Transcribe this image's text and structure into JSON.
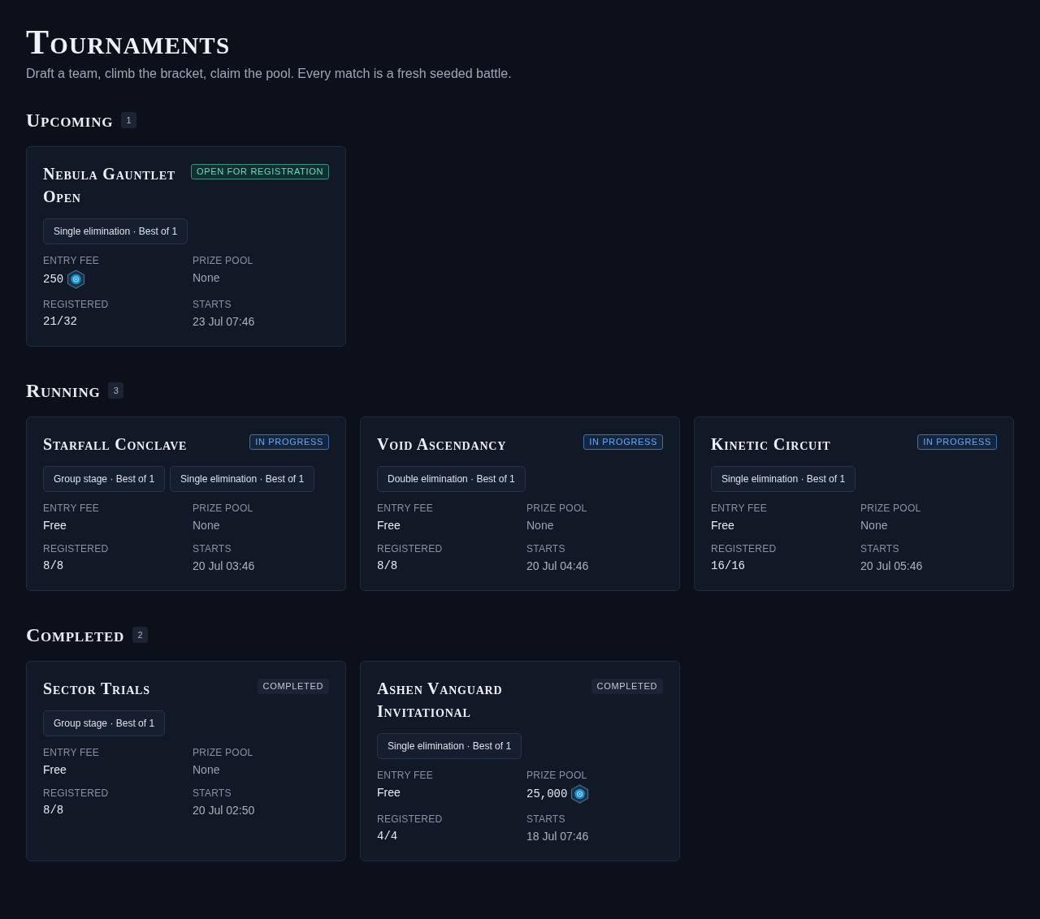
{
  "page": {
    "title": "Tournaments",
    "subtitle": "Draft a team, climb the bracket, claim the pool. Every match is a fresh seeded battle."
  },
  "sections": [
    {
      "title": "Upcoming",
      "count": "1",
      "cards": [
        {
          "title": "Nebula Gauntlet Open",
          "status": {
            "label": "OPEN FOR REGISTRATION",
            "kind": "open"
          },
          "formats": [
            "Single elimination · Best of 1"
          ],
          "stats": [
            {
              "label": "ENTRY FEE",
              "value": "250",
              "kind": "coins"
            },
            {
              "label": "PRIZE POOL",
              "value": "None",
              "kind": "none"
            },
            {
              "label": "REGISTERED",
              "value": "21/32",
              "kind": "count"
            },
            {
              "label": "STARTS",
              "value": "23 Jul 07:46",
              "kind": "date"
            }
          ]
        }
      ]
    },
    {
      "title": "Running",
      "count": "3",
      "cards": [
        {
          "title": "Starfall Conclave",
          "status": {
            "label": "IN PROGRESS",
            "kind": "running"
          },
          "formats": [
            "Group stage · Best of 1",
            "Single elimination · Best of 1"
          ],
          "stats": [
            {
              "label": "ENTRY FEE",
              "value": "Free",
              "kind": "free"
            },
            {
              "label": "PRIZE POOL",
              "value": "None",
              "kind": "none"
            },
            {
              "label": "REGISTERED",
              "value": "8/8",
              "kind": "count"
            },
            {
              "label": "STARTS",
              "value": "20 Jul 03:46",
              "kind": "date"
            }
          ]
        },
        {
          "title": "Void Ascendancy",
          "status": {
            "label": "IN PROGRESS",
            "kind": "running"
          },
          "formats": [
            "Double elimination · Best of 1"
          ],
          "stats": [
            {
              "label": "ENTRY FEE",
              "value": "Free",
              "kind": "free"
            },
            {
              "label": "PRIZE POOL",
              "value": "None",
              "kind": "none"
            },
            {
              "label": "REGISTERED",
              "value": "8/8",
              "kind": "count"
            },
            {
              "label": "STARTS",
              "value": "20 Jul 04:46",
              "kind": "date"
            }
          ]
        },
        {
          "title": "Kinetic Circuit",
          "status": {
            "label": "IN PROGRESS",
            "kind": "running"
          },
          "formats": [
            "Single elimination · Best of 1"
          ],
          "stats": [
            {
              "label": "ENTRY FEE",
              "value": "Free",
              "kind": "free"
            },
            {
              "label": "PRIZE POOL",
              "value": "None",
              "kind": "none"
            },
            {
              "label": "REGISTERED",
              "value": "16/16",
              "kind": "count"
            },
            {
              "label": "STARTS",
              "value": "20 Jul 05:46",
              "kind": "date"
            }
          ]
        }
      ]
    },
    {
      "title": "Completed",
      "count": "2",
      "cards": [
        {
          "title": "Sector Trials",
          "status": {
            "label": "COMPLETED",
            "kind": "completed"
          },
          "formats": [
            "Group stage · Best of 1"
          ],
          "stats": [
            {
              "label": "ENTRY FEE",
              "value": "Free",
              "kind": "free"
            },
            {
              "label": "PRIZE POOL",
              "value": "None",
              "kind": "none"
            },
            {
              "label": "REGISTERED",
              "value": "8/8",
              "kind": "count"
            },
            {
              "label": "STARTS",
              "value": "20 Jul 02:50",
              "kind": "date"
            }
          ]
        },
        {
          "title": "Ashen Vanguard Invitational",
          "status": {
            "label": "COMPLETED",
            "kind": "completed"
          },
          "formats": [
            "Single elimination · Best of 1"
          ],
          "stats": [
            {
              "label": "ENTRY FEE",
              "value": "Free",
              "kind": "free"
            },
            {
              "label": "PRIZE POOL",
              "value": "25,000",
              "kind": "coins"
            },
            {
              "label": "REGISTERED",
              "value": "4/4",
              "kind": "count"
            },
            {
              "label": "STARTS",
              "value": "18 Jul 07:46",
              "kind": "date"
            }
          ]
        }
      ]
    }
  ]
}
